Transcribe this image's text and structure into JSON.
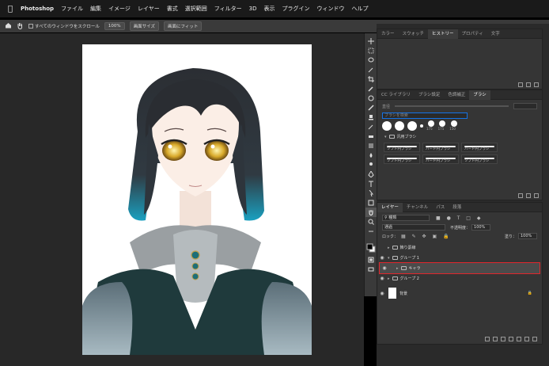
{
  "menubar": {
    "app": "Photoshop",
    "items": [
      "ファイル",
      "編集",
      "イメージ",
      "レイヤー",
      "書式",
      "選択範囲",
      "フィルター",
      "3D",
      "表示",
      "プラグイン",
      "ウィンドウ",
      "ヘルプ"
    ]
  },
  "options": {
    "scroll_all": "すべてのウィンドウをスクロール",
    "zoom": "100%",
    "fit_screen": "画面サイズ",
    "fill_screen": "画面にフィット"
  },
  "history_panel": {
    "tabs": [
      "カラー",
      "スウォッチ",
      "ヒストリー",
      "プロパティ",
      "文字"
    ],
    "active_tab": "ヒストリー"
  },
  "brush_panel": {
    "tabs": [
      "CC ライブラリ",
      "ブラシ設定",
      "色調補正",
      "ブラシ"
    ],
    "active_tab": "ブラシ",
    "size_label": "直径",
    "search_placeholder": "ブラシを検索",
    "sizes": [
      "175",
      "175",
      "150"
    ],
    "group_name": "汎用ブラシ",
    "brushes": [
      "ソフト円ブラシ",
      "ハード円ブラシ",
      "ハード円ブラシ",
      "ソフト円ブラシ",
      "ハード円ブラシ",
      "ソフト円ブラシ"
    ]
  },
  "layers_panel": {
    "tabs": [
      "レイヤー",
      "チャンネル",
      "パス",
      "段落"
    ],
    "active_tab": "レイヤー",
    "filter_kind": "種類",
    "blend_mode": "通過",
    "opacity_label": "不透明度：",
    "opacity_value": "100%",
    "lock_label": "ロック：",
    "fill_label": "塗り：",
    "fill_value": "100%",
    "layers": [
      {
        "name": "飾り罫線",
        "indent": 0,
        "visible": false,
        "selected": false,
        "type": "folder"
      },
      {
        "name": "グループ 1",
        "indent": 0,
        "visible": true,
        "selected": false,
        "type": "folder"
      },
      {
        "name": "キャラ",
        "indent": 1,
        "visible": true,
        "selected": true,
        "type": "folder"
      },
      {
        "name": "グループ 2",
        "indent": 0,
        "visible": true,
        "selected": false,
        "type": "folder"
      },
      {
        "name": "背景",
        "indent": 0,
        "visible": true,
        "selected": false,
        "type": "image"
      }
    ]
  },
  "colors": {
    "selection_outline": "#e0262c",
    "accent_blue": "#1473e6"
  }
}
